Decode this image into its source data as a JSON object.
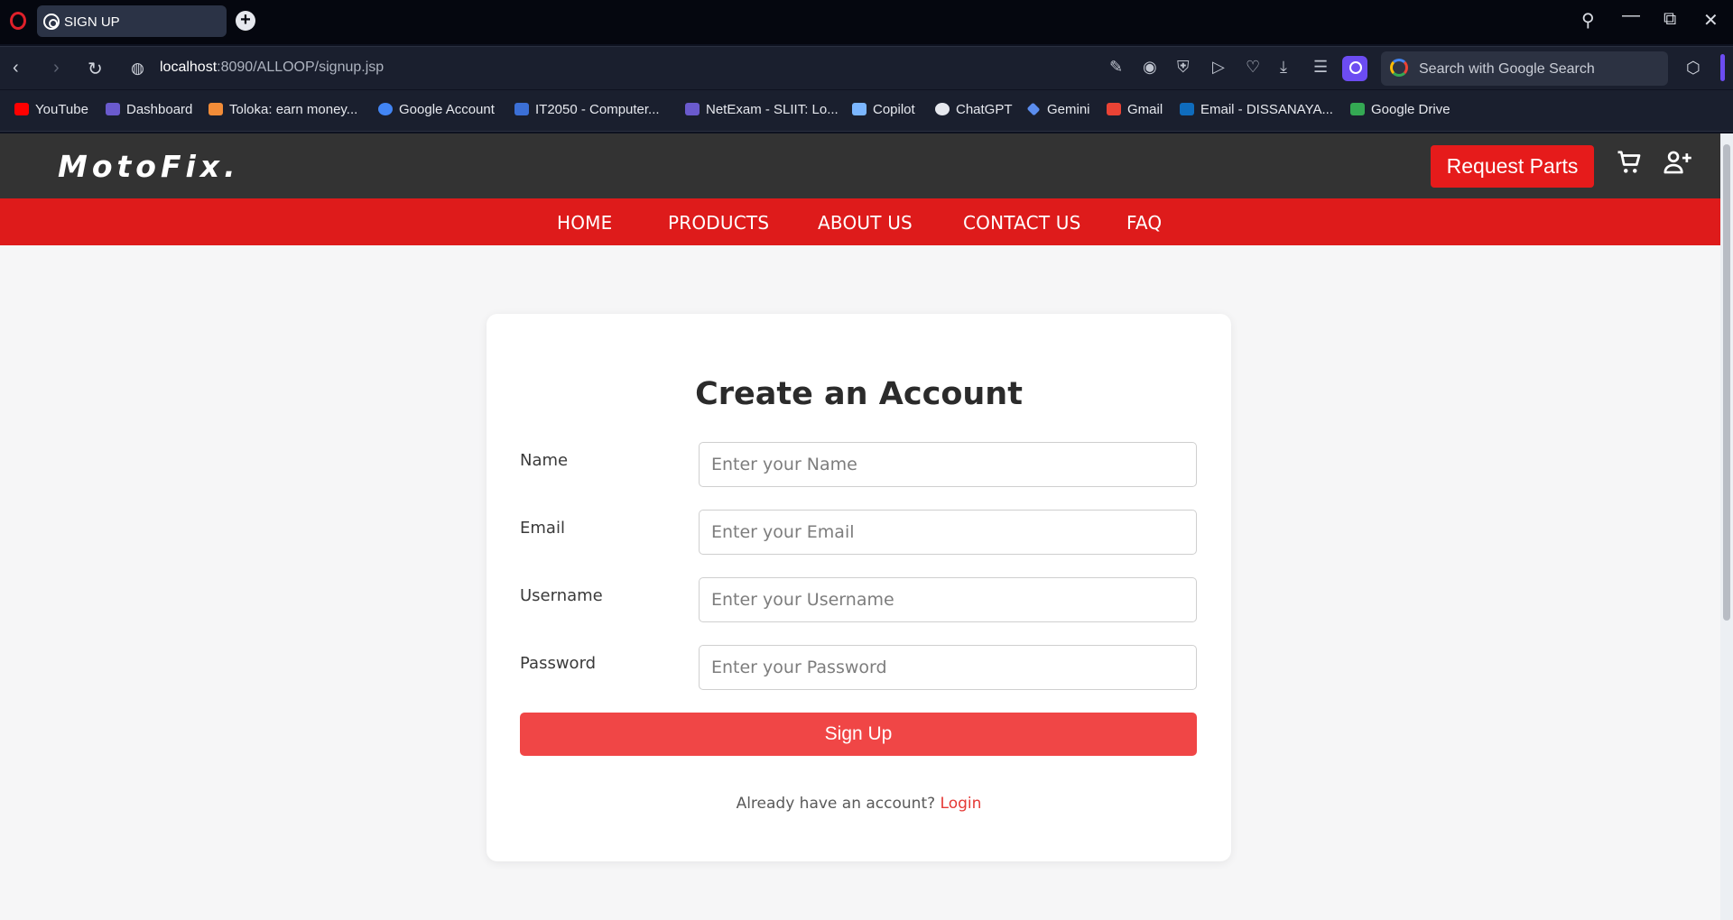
{
  "browser": {
    "tab_title": "SIGN UP",
    "url_host": "localhost",
    "url_path": ":8090/ALLOOP/signup.jsp",
    "search_placeholder": "Search with Google Search",
    "bookmarks": [
      {
        "label": "YouTube",
        "color": "#ff0000"
      },
      {
        "label": "Dashboard",
        "color": "#6a5acd"
      },
      {
        "label": "Toloka: earn money...",
        "color": "#f28c38"
      },
      {
        "label": "Google Account",
        "color": "#4285f4"
      },
      {
        "label": "IT2050 - Computer...",
        "color": "#3b6fd6"
      },
      {
        "label": "NetExam - SLIIT: Lo...",
        "color": "#6a5acd"
      },
      {
        "label": "Copilot",
        "color": "#7bb6ff"
      },
      {
        "label": "ChatGPT",
        "color": "#e6e8ee"
      },
      {
        "label": "Gemini",
        "color": "#5b8def"
      },
      {
        "label": "Gmail",
        "color": "#ea4335"
      },
      {
        "label": "Email - DISSANAYA...",
        "color": "#0f6cbd"
      },
      {
        "label": "Google Drive",
        "color": "#34a853"
      }
    ]
  },
  "site": {
    "logo": "MotoFix.",
    "request_button": "Request Parts",
    "nav": [
      "HOME",
      "PRODUCTS",
      "ABOUT US",
      "CONTACT US",
      "FAQ"
    ],
    "colors": {
      "header": "#333333",
      "nav": "#de1b1b",
      "accent": "#f04646"
    }
  },
  "form": {
    "title": "Create an Account",
    "fields": [
      {
        "label": "Name",
        "placeholder": "Enter your Name",
        "value": ""
      },
      {
        "label": "Email",
        "placeholder": "Enter your Email",
        "value": ""
      },
      {
        "label": "Username",
        "placeholder": "Enter your Username",
        "value": ""
      },
      {
        "label": "Password",
        "placeholder": "Enter your Password",
        "value": ""
      }
    ],
    "submit_label": "Sign Up",
    "login_prompt": "Already have an account?",
    "login_link": "Login"
  }
}
